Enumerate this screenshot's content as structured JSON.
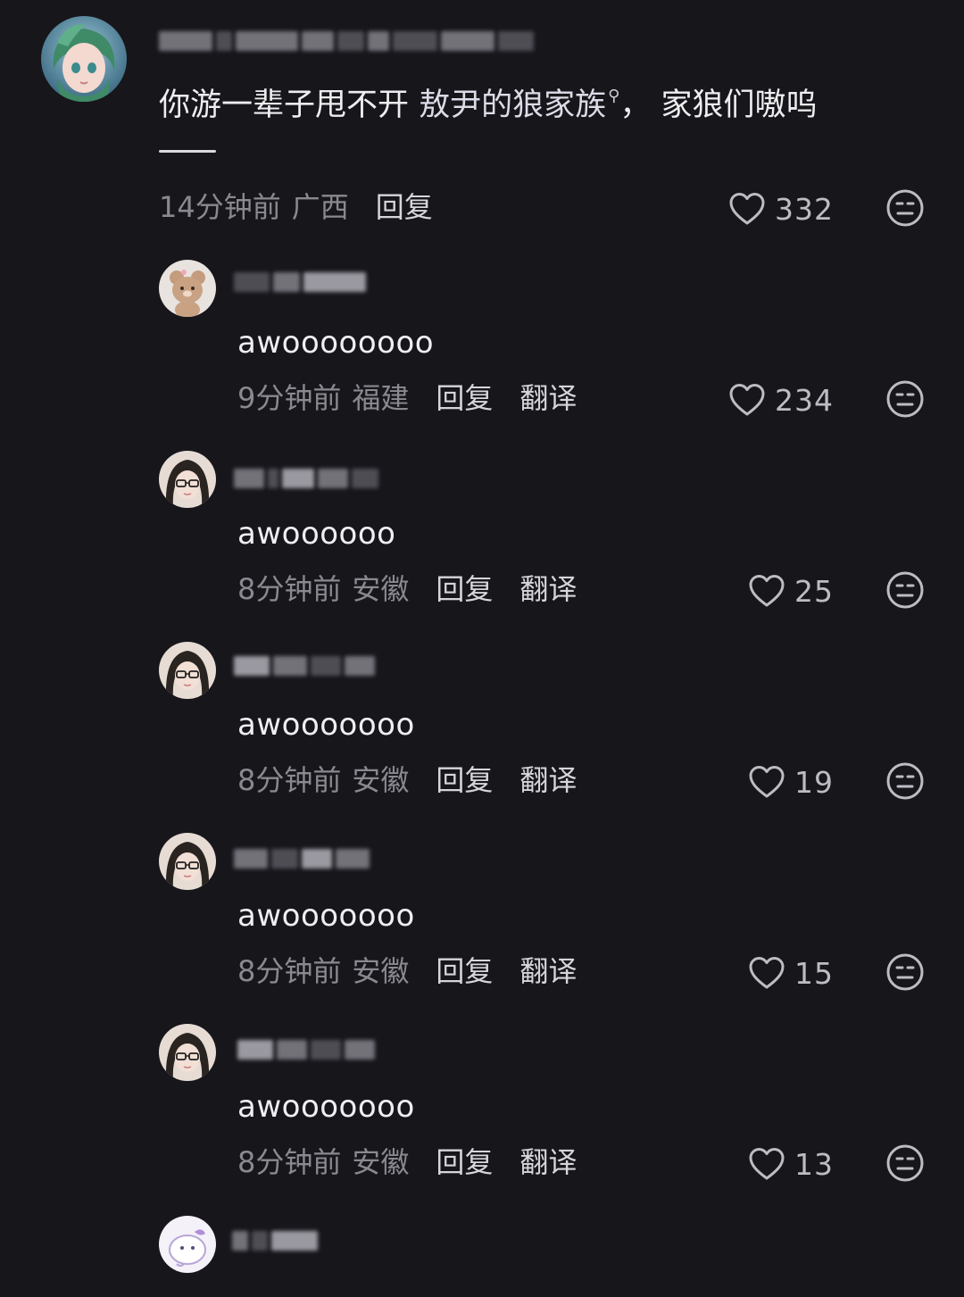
{
  "main_comment": {
    "text_prefix": "你游一辈子甩不开 ",
    "link_text": "敖尹的狼家族",
    "text_suffix": "， 家狼们嗷呜",
    "time": "14分钟前",
    "region": "广西",
    "reply_label": "回复",
    "likes": "332",
    "search_glyph": "⚲"
  },
  "replies": [
    {
      "text": "awoooooooo",
      "time": "9分钟前",
      "region": "福建",
      "reply_label": "回复",
      "translate_label": "翻译",
      "likes": "234"
    },
    {
      "text": "awoooooo",
      "time": "8分钟前",
      "region": "安徽",
      "reply_label": "回复",
      "translate_label": "翻译",
      "likes": "25"
    },
    {
      "text": "awooooooo",
      "time": "8分钟前",
      "region": "安徽",
      "reply_label": "回复",
      "translate_label": "翻译",
      "likes": "19"
    },
    {
      "text": "awooooooo",
      "time": "8分钟前",
      "region": "安徽",
      "reply_label": "回复",
      "translate_label": "翻译",
      "likes": "15"
    },
    {
      "text": "awooooooo",
      "time": "8分钟前",
      "region": "安徽",
      "reply_label": "回复",
      "translate_label": "翻译",
      "likes": "13"
    }
  ],
  "colors": {
    "background": "#17161b",
    "text_primary": "#eeeef0",
    "text_secondary": "#8a8990",
    "icon": "#bdbcc3"
  },
  "icons": {
    "like": "heart-outline-icon",
    "dislike": "neutral-face-icon"
  }
}
